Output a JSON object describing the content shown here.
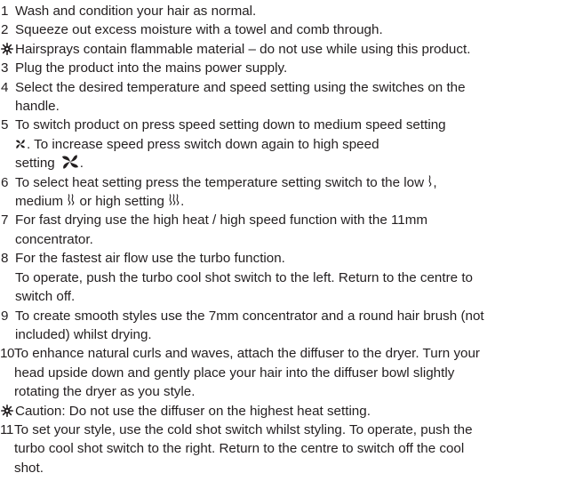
{
  "instructions": [
    {
      "num": "1",
      "lines": [
        "Wash and condition your hair as normal."
      ]
    },
    {
      "num": "2",
      "lines": [
        "Squeeze out excess moisture with a towel and comb through."
      ]
    },
    {
      "num": "",
      "warning": true,
      "lines": [
        "Hairsprays contain flammable material – do not use while using this product."
      ]
    },
    {
      "num": "3",
      "lines": [
        "Plug the product into the mains power supply."
      ]
    },
    {
      "num": "4",
      "lines": [
        "Select the desired temperature and speed setting using the switches on the",
        "handle."
      ]
    },
    {
      "num": "5",
      "lines": [
        "To switch product on press speed setting down to medium speed setting",
        ". To increase speed press switch down again to high speed",
        "setting"
      ]
    },
    {
      "num": "6",
      "lines": [
        "To select heat setting press the temperature setting switch to the low",
        "medium",
        "or high setting",
        "."
      ]
    },
    {
      "num": "7",
      "lines": [
        "For fast drying use the high heat / high speed function with the 11mm",
        "concentrator."
      ]
    },
    {
      "num": "8",
      "lines": [
        "For the fastest air flow use the turbo function.",
        "To operate, push the turbo cool shot switch to the left. Return to the centre to",
        "switch off."
      ]
    },
    {
      "num": "9",
      "lines": [
        "To create smooth styles use the 7mm concentrator and a round hair brush (not",
        "included) whilst drying."
      ]
    },
    {
      "num": "10",
      "lines": [
        "To enhance natural curls and waves, attach the diffuser to the dryer. Turn your",
        "head upside down and gently place your hair into the diffuser bowl slightly",
        "rotating the dryer as you style."
      ]
    },
    {
      "num": "",
      "warning": true,
      "lines": [
        "Caution: Do not use the diffuser on the highest heat setting."
      ]
    },
    {
      "num": "11",
      "lines": [
        "To set your style, use the cold shot switch whilst styling. To operate, push the",
        "turbo cool shot switch to the right. Return to the centre to switch off the cool",
        "shot."
      ]
    }
  ],
  "icons": {
    "warning": "warning-sun-icon",
    "fan_medium": "fan-medium-speed-icon",
    "fan_high": "fan-high-speed-icon",
    "heat_low": "heat-low-icon",
    "heat_medium": "heat-medium-icon",
    "heat_high": "heat-high-icon"
  },
  "colors": {
    "text": "#231f20",
    "background": "#ffffff"
  }
}
